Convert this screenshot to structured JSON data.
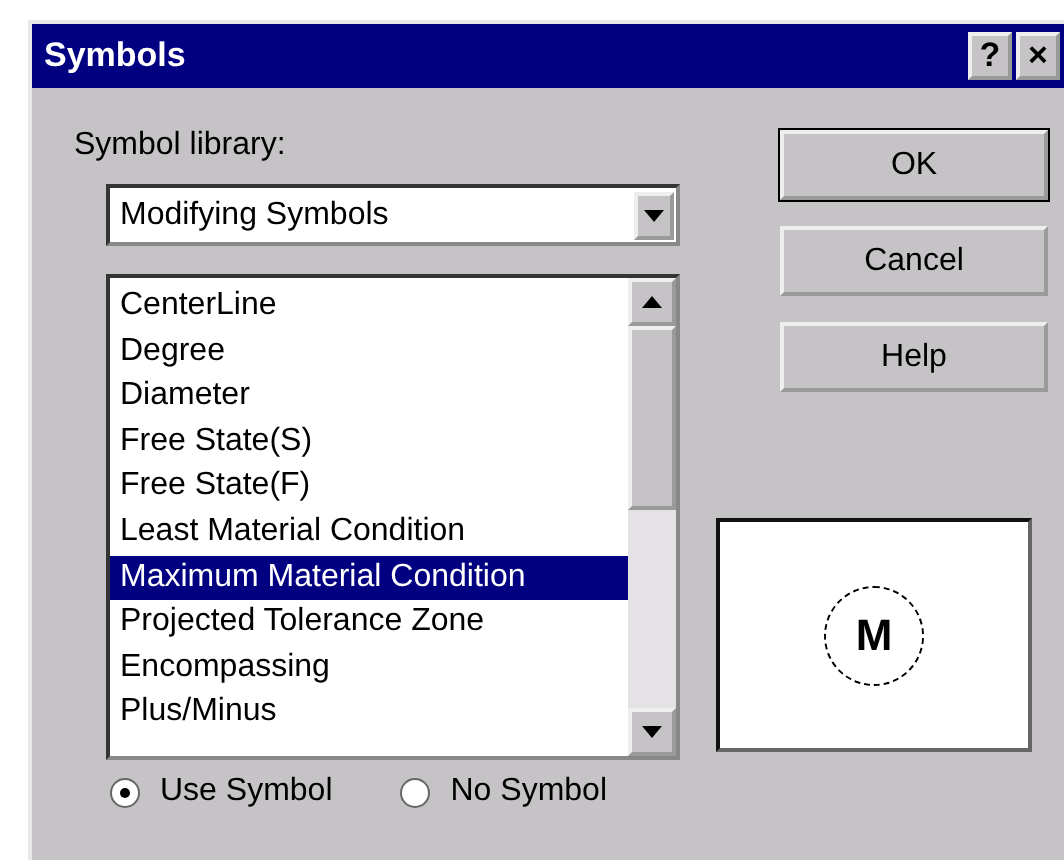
{
  "window": {
    "title": "Symbols",
    "title_buttons": [
      "?",
      "×"
    ]
  },
  "library": {
    "label": "Symbol library:",
    "value": "Modifying Symbols"
  },
  "symbols": [
    {
      "label": "CenterLine",
      "selected": false
    },
    {
      "label": "Degree",
      "selected": false
    },
    {
      "label": "Diameter",
      "selected": false
    },
    {
      "label": "Free State(S)",
      "selected": false
    },
    {
      "label": "Free State(F)",
      "selected": false
    },
    {
      "label": "Least Material Condition",
      "selected": false
    },
    {
      "label": "Maximum Material Condition",
      "selected": true
    },
    {
      "label": "Projected Tolerance Zone",
      "selected": false
    },
    {
      "label": "Encompassing",
      "selected": false
    },
    {
      "label": "Plus/Minus",
      "selected": false
    }
  ],
  "options": [
    {
      "label": "Use Symbol",
      "selected": true
    },
    {
      "label": "No Symbol",
      "selected": false
    }
  ],
  "buttons": [
    "OK",
    "Cancel",
    "Help"
  ],
  "preview": {
    "symbol": "M"
  }
}
